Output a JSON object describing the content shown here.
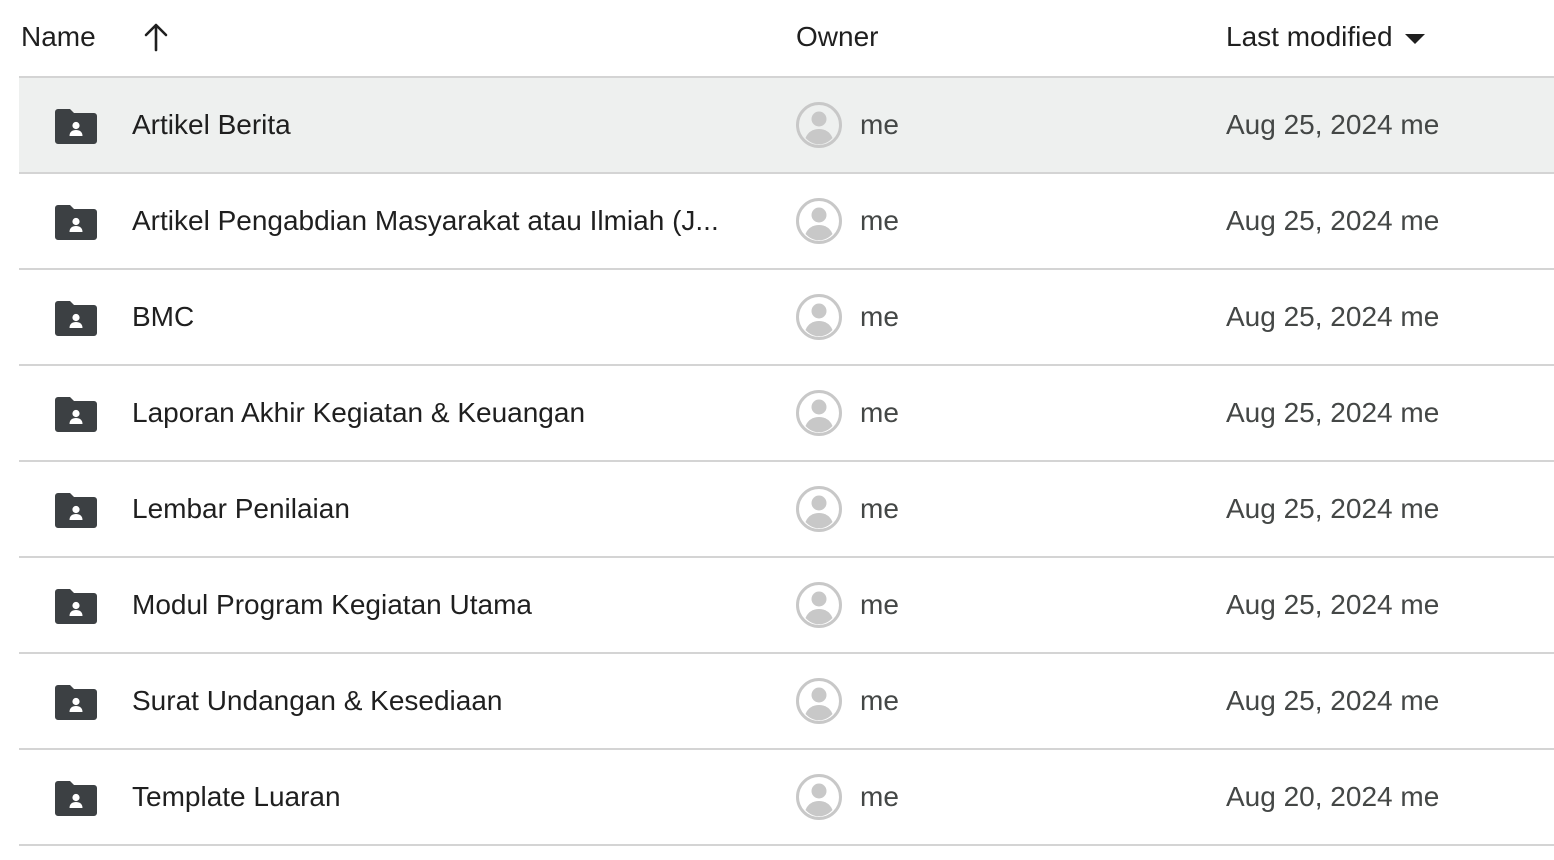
{
  "header": {
    "name_label": "Name",
    "sort_icon": "arrow-up-icon",
    "owner_label": "Owner",
    "modified_label": "Last modified",
    "modified_sort_icon": "caret-down-icon"
  },
  "colors": {
    "folder": "#3c4043",
    "avatar": "#c8c8c8",
    "selected_row": "#eef0ef",
    "divider": "#d4d4d4"
  },
  "rows": [
    {
      "name": "Artikel Berita",
      "owner": "me",
      "modified": "Aug 25, 2024",
      "modified_by": "me",
      "icon": "shared-folder-icon",
      "selected": true
    },
    {
      "name": "Artikel Pengabdian Masyarakat atau Ilmiah (J...",
      "owner": "me",
      "modified": "Aug 25, 2024",
      "modified_by": "me",
      "icon": "shared-folder-icon",
      "selected": false
    },
    {
      "name": "BMC",
      "owner": "me",
      "modified": "Aug 25, 2024",
      "modified_by": "me",
      "icon": "shared-folder-icon",
      "selected": false
    },
    {
      "name": "Laporan Akhir Kegiatan & Keuangan",
      "owner": "me",
      "modified": "Aug 25, 2024",
      "modified_by": "me",
      "icon": "shared-folder-icon",
      "selected": false
    },
    {
      "name": "Lembar Penilaian",
      "owner": "me",
      "modified": "Aug 25, 2024",
      "modified_by": "me",
      "icon": "shared-folder-icon",
      "selected": false
    },
    {
      "name": "Modul Program Kegiatan Utama",
      "owner": "me",
      "modified": "Aug 25, 2024",
      "modified_by": "me",
      "icon": "shared-folder-icon",
      "selected": false
    },
    {
      "name": "Surat Undangan & Kesediaan",
      "owner": "me",
      "modified": "Aug 25, 2024",
      "modified_by": "me",
      "icon": "shared-folder-icon",
      "selected": false
    },
    {
      "name": "Template Luaran",
      "owner": "me",
      "modified": "Aug 20, 2024",
      "modified_by": "me",
      "icon": "shared-folder-icon",
      "selected": false
    }
  ]
}
